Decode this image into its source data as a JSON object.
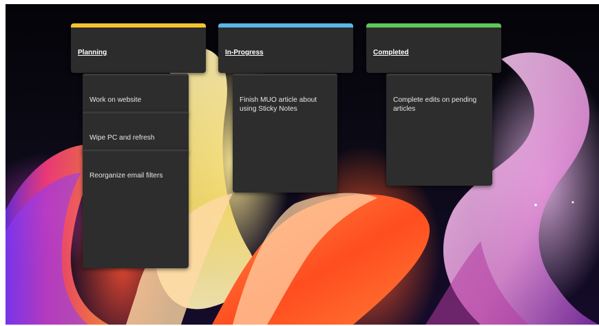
{
  "board": {
    "columns": [
      {
        "title": "Planning",
        "accent": "#f4c430",
        "notes": [
          "Work on website",
          "Wipe PC and refresh",
          "Reorganize email filters"
        ]
      },
      {
        "title": "In-Progress",
        "accent": "#5ab6e6",
        "notes": [
          "Finish MUO article about using Sticky Notes"
        ]
      },
      {
        "title": "Completed",
        "accent": "#5cc85a",
        "notes": [
          "Complete edits on pending articles"
        ]
      }
    ]
  },
  "wallpaper": {
    "colors": [
      "#0a0914",
      "#ff5a28",
      "#f6e38f",
      "#e3b7e6"
    ]
  }
}
